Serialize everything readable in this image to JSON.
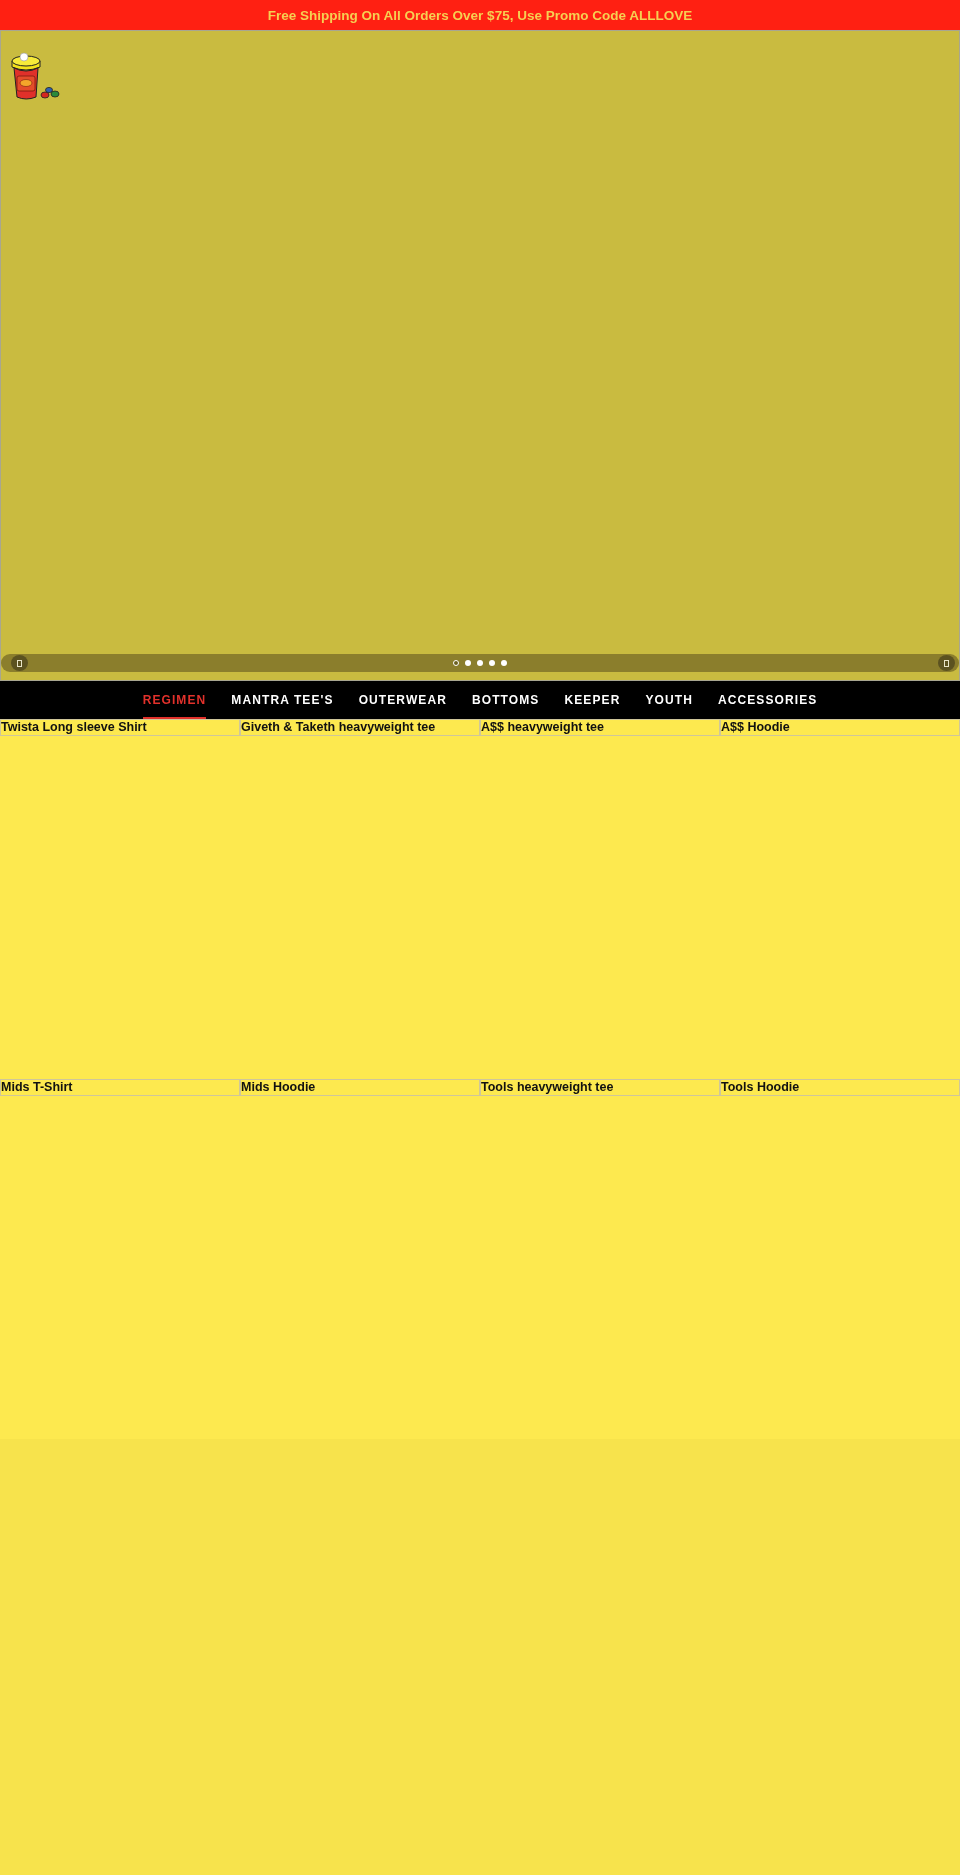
{
  "announcement": {
    "text": "Free Shipping On All Orders Over $75, Use Promo Code ALLLOVE"
  },
  "slideshow": {
    "slides": [
      {
        "selected": true
      },
      {
        "selected": false
      },
      {
        "selected": false
      },
      {
        "selected": false
      },
      {
        "selected": false
      }
    ]
  },
  "nav": [
    {
      "label": "REGIMEN",
      "selected": true
    },
    {
      "label": "MANTRA TEE'S",
      "selected": false
    },
    {
      "label": "OUTERWEAR",
      "selected": false
    },
    {
      "label": "BOTTOMS",
      "selected": false
    },
    {
      "label": "KEEPER",
      "selected": false
    },
    {
      "label": "YOUTH",
      "selected": false
    },
    {
      "label": "ACCESSORIES",
      "selected": false
    }
  ],
  "products": [
    {
      "title": "Twista Long sleeve Shirt"
    },
    {
      "title": "Giveth & Taketh heavyweight tee"
    },
    {
      "title": "A$$ heavyweight tee"
    },
    {
      "title": "A$$ Hoodie"
    },
    {
      "title": "Mids T-Shirt"
    },
    {
      "title": "Mids Hoodie"
    },
    {
      "title": "Tools heavyweight tee"
    },
    {
      "title": "Tools Hoodie"
    }
  ]
}
